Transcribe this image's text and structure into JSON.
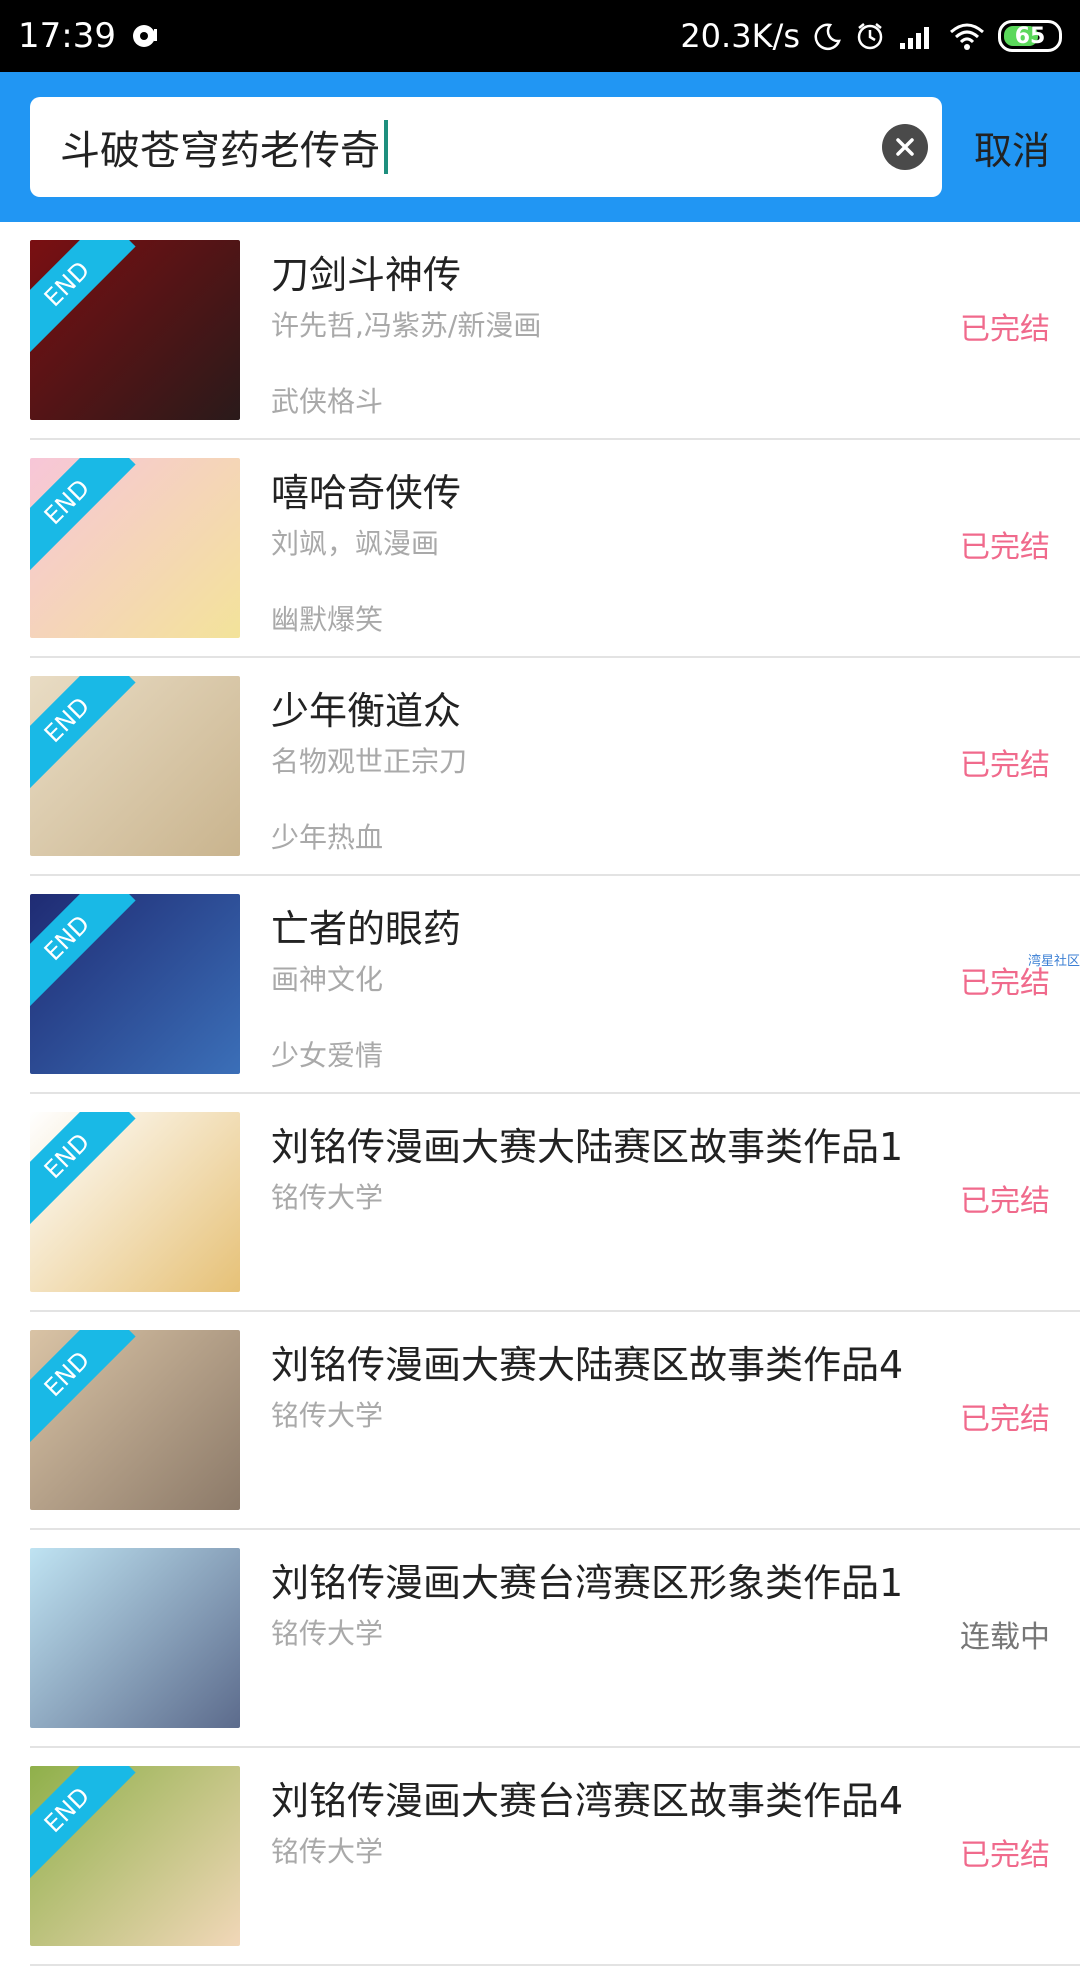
{
  "status_bar": {
    "time": "17:39",
    "speed": "20.3K/s",
    "battery": "65"
  },
  "search": {
    "query": "斗破苍穹药老传奇",
    "cancel_label": "取消"
  },
  "results": [
    {
      "title": "刀剑斗神传",
      "author": "许先哲,冯紫苏/新漫画",
      "genre": "武侠格斗",
      "status": "已完结",
      "finished": true,
      "end_badge": "END",
      "cover_colors": [
        "#7a0f12",
        "#2a1a1a"
      ]
    },
    {
      "title": "嘻哈奇侠传",
      "author": "刘飒，飒漫画",
      "genre": "幽默爆笑",
      "status": "已完结",
      "finished": true,
      "end_badge": "END",
      "cover_colors": [
        "#f7c6d8",
        "#f3e39a"
      ]
    },
    {
      "title": "少年衡道众",
      "author": "名物观世正宗刀",
      "genre": "少年热血",
      "status": "已完结",
      "finished": true,
      "end_badge": "END",
      "cover_colors": [
        "#e9dcc4",
        "#c9b48e"
      ]
    },
    {
      "title": "亡者的眼药",
      "author": "画神文化",
      "genre": "少女爱情",
      "status": "已完结",
      "finished": true,
      "end_badge": "END",
      "cover_colors": [
        "#1f2b73",
        "#3b6fb8"
      ]
    },
    {
      "title": "刘铭传漫画大赛大陆赛区故事类作品1",
      "author": "铭传大学",
      "genre": "",
      "status": "已完结",
      "finished": true,
      "end_badge": "END",
      "cover_colors": [
        "#ffffff",
        "#e6c177"
      ]
    },
    {
      "title": "刘铭传漫画大赛大陆赛区故事类作品4",
      "author": "铭传大学",
      "genre": "",
      "status": "已完结",
      "finished": true,
      "end_badge": "END",
      "cover_colors": [
        "#d9c3a5",
        "#8c7a69"
      ]
    },
    {
      "title": "刘铭传漫画大赛台湾赛区形象类作品1",
      "author": "铭传大学",
      "genre": "",
      "status": "连载中",
      "finished": false,
      "end_badge": "",
      "cover_colors": [
        "#bfe3f2",
        "#5c6b8c"
      ]
    },
    {
      "title": "刘铭传漫画大赛台湾赛区故事类作品4",
      "author": "铭传大学",
      "genre": "",
      "status": "已完结",
      "finished": true,
      "end_badge": "END",
      "cover_colors": [
        "#8fb04a",
        "#f1d7b8"
      ]
    }
  ],
  "watermark": "湾星社区",
  "colors": {
    "accent": "#2196f3",
    "finished": "#f06a8c",
    "ongoing": "#777777",
    "end_badge": "#19b9e6"
  }
}
